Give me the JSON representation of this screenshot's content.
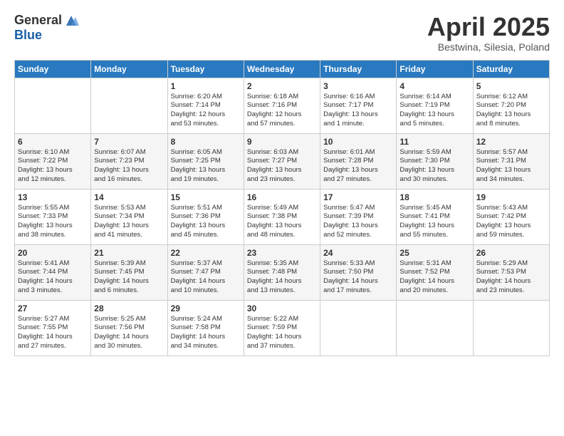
{
  "logo": {
    "general": "General",
    "blue": "Blue"
  },
  "title": "April 2025",
  "subtitle": "Bestwina, Silesia, Poland",
  "headers": [
    "Sunday",
    "Monday",
    "Tuesday",
    "Wednesday",
    "Thursday",
    "Friday",
    "Saturday"
  ],
  "weeks": [
    [
      {
        "day": "",
        "info": ""
      },
      {
        "day": "",
        "info": ""
      },
      {
        "day": "1",
        "info": "Sunrise: 6:20 AM\nSunset: 7:14 PM\nDaylight: 12 hours\nand 53 minutes."
      },
      {
        "day": "2",
        "info": "Sunrise: 6:18 AM\nSunset: 7:16 PM\nDaylight: 12 hours\nand 57 minutes."
      },
      {
        "day": "3",
        "info": "Sunrise: 6:16 AM\nSunset: 7:17 PM\nDaylight: 13 hours\nand 1 minute."
      },
      {
        "day": "4",
        "info": "Sunrise: 6:14 AM\nSunset: 7:19 PM\nDaylight: 13 hours\nand 5 minutes."
      },
      {
        "day": "5",
        "info": "Sunrise: 6:12 AM\nSunset: 7:20 PM\nDaylight: 13 hours\nand 8 minutes."
      }
    ],
    [
      {
        "day": "6",
        "info": "Sunrise: 6:10 AM\nSunset: 7:22 PM\nDaylight: 13 hours\nand 12 minutes."
      },
      {
        "day": "7",
        "info": "Sunrise: 6:07 AM\nSunset: 7:23 PM\nDaylight: 13 hours\nand 16 minutes."
      },
      {
        "day": "8",
        "info": "Sunrise: 6:05 AM\nSunset: 7:25 PM\nDaylight: 13 hours\nand 19 minutes."
      },
      {
        "day": "9",
        "info": "Sunrise: 6:03 AM\nSunset: 7:27 PM\nDaylight: 13 hours\nand 23 minutes."
      },
      {
        "day": "10",
        "info": "Sunrise: 6:01 AM\nSunset: 7:28 PM\nDaylight: 13 hours\nand 27 minutes."
      },
      {
        "day": "11",
        "info": "Sunrise: 5:59 AM\nSunset: 7:30 PM\nDaylight: 13 hours\nand 30 minutes."
      },
      {
        "day": "12",
        "info": "Sunrise: 5:57 AM\nSunset: 7:31 PM\nDaylight: 13 hours\nand 34 minutes."
      }
    ],
    [
      {
        "day": "13",
        "info": "Sunrise: 5:55 AM\nSunset: 7:33 PM\nDaylight: 13 hours\nand 38 minutes."
      },
      {
        "day": "14",
        "info": "Sunrise: 5:53 AM\nSunset: 7:34 PM\nDaylight: 13 hours\nand 41 minutes."
      },
      {
        "day": "15",
        "info": "Sunrise: 5:51 AM\nSunset: 7:36 PM\nDaylight: 13 hours\nand 45 minutes."
      },
      {
        "day": "16",
        "info": "Sunrise: 5:49 AM\nSunset: 7:38 PM\nDaylight: 13 hours\nand 48 minutes."
      },
      {
        "day": "17",
        "info": "Sunrise: 5:47 AM\nSunset: 7:39 PM\nDaylight: 13 hours\nand 52 minutes."
      },
      {
        "day": "18",
        "info": "Sunrise: 5:45 AM\nSunset: 7:41 PM\nDaylight: 13 hours\nand 55 minutes."
      },
      {
        "day": "19",
        "info": "Sunrise: 5:43 AM\nSunset: 7:42 PM\nDaylight: 13 hours\nand 59 minutes."
      }
    ],
    [
      {
        "day": "20",
        "info": "Sunrise: 5:41 AM\nSunset: 7:44 PM\nDaylight: 14 hours\nand 3 minutes."
      },
      {
        "day": "21",
        "info": "Sunrise: 5:39 AM\nSunset: 7:45 PM\nDaylight: 14 hours\nand 6 minutes."
      },
      {
        "day": "22",
        "info": "Sunrise: 5:37 AM\nSunset: 7:47 PM\nDaylight: 14 hours\nand 10 minutes."
      },
      {
        "day": "23",
        "info": "Sunrise: 5:35 AM\nSunset: 7:48 PM\nDaylight: 14 hours\nand 13 minutes."
      },
      {
        "day": "24",
        "info": "Sunrise: 5:33 AM\nSunset: 7:50 PM\nDaylight: 14 hours\nand 17 minutes."
      },
      {
        "day": "25",
        "info": "Sunrise: 5:31 AM\nSunset: 7:52 PM\nDaylight: 14 hours\nand 20 minutes."
      },
      {
        "day": "26",
        "info": "Sunrise: 5:29 AM\nSunset: 7:53 PM\nDaylight: 14 hours\nand 23 minutes."
      }
    ],
    [
      {
        "day": "27",
        "info": "Sunrise: 5:27 AM\nSunset: 7:55 PM\nDaylight: 14 hours\nand 27 minutes."
      },
      {
        "day": "28",
        "info": "Sunrise: 5:25 AM\nSunset: 7:56 PM\nDaylight: 14 hours\nand 30 minutes."
      },
      {
        "day": "29",
        "info": "Sunrise: 5:24 AM\nSunset: 7:58 PM\nDaylight: 14 hours\nand 34 minutes."
      },
      {
        "day": "30",
        "info": "Sunrise: 5:22 AM\nSunset: 7:59 PM\nDaylight: 14 hours\nand 37 minutes."
      },
      {
        "day": "",
        "info": ""
      },
      {
        "day": "",
        "info": ""
      },
      {
        "day": "",
        "info": ""
      }
    ]
  ]
}
